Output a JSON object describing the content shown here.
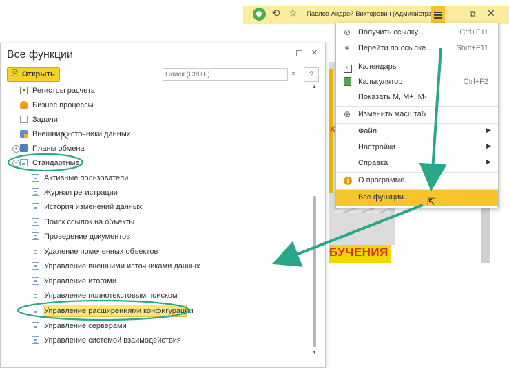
{
  "topbar": {
    "user": "Павлов Андрей Викторович (Администратор)",
    "icons": [
      "home-icon",
      "history-icon",
      "favorites-star-icon"
    ],
    "controls": [
      "minimize",
      "restore",
      "close"
    ]
  },
  "menu": {
    "items": [
      {
        "label": "Получить ссылку...",
        "shortcut": "Ctrl+F11",
        "icon": "paperclip-icon"
      },
      {
        "label": "Перейти по ссылке...",
        "shortcut": "Shift+F11",
        "icon": "link-icon"
      },
      {
        "label": "Календарь",
        "shortcut": "",
        "icon": "calendar-icon"
      },
      {
        "label": "Калькулятор",
        "shortcut": "Ctrl+F2",
        "icon": "calculator-icon"
      },
      {
        "label": "Показать М, М+, М-",
        "shortcut": "",
        "icon": ""
      },
      {
        "label": "Изменить масштаб",
        "shortcut": "",
        "icon": "zoom-icon"
      },
      {
        "label": "Файл",
        "shortcut": "",
        "icon": "",
        "submenu": true
      },
      {
        "label": "Настройки",
        "shortcut": "",
        "icon": "",
        "submenu": true
      },
      {
        "label": "Справка",
        "shortcut": "",
        "icon": "",
        "submenu": true
      },
      {
        "label": "О программе...",
        "shortcut": "",
        "icon": "info-icon"
      },
      {
        "label": "Все функции...",
        "shortcut": "",
        "icon": "",
        "highlighted": true
      }
    ]
  },
  "background": {
    "banner_text": "БУЧЕНИЯ",
    "side_text": "K"
  },
  "window": {
    "title": "Все функции",
    "open_label": "Открыть",
    "search_placeholder": "Поиск (Ctrl+F)",
    "search_clear": "×",
    "help_label": "?",
    "maximize_glyph": "☐",
    "close_glyph": "×",
    "tree": [
      {
        "label": "Регистры расчета",
        "icon": "register-icon",
        "level": 0
      },
      {
        "label": "Бизнес процессы",
        "icon": "business-process-icon",
        "level": 0
      },
      {
        "label": "Задачи",
        "icon": "task-icon",
        "level": 0
      },
      {
        "label": "Внешние источники данных",
        "icon": "external-data-icon",
        "level": 0
      },
      {
        "label": "Планы обмена",
        "icon": "exchange-plan-icon",
        "level": 0,
        "expander": "+"
      },
      {
        "label": "Стандартные",
        "icon": "folder-icon",
        "level": 0,
        "expander": "−",
        "circled": true
      },
      {
        "label": "Активные пользователи",
        "icon": "form-icon",
        "level": 1
      },
      {
        "label": "Журнал регистрации",
        "icon": "form-icon",
        "level": 1
      },
      {
        "label": "История изменений данных",
        "icon": "form-icon",
        "level": 1
      },
      {
        "label": "Поиск ссылок на объекты",
        "icon": "form-icon",
        "level": 1
      },
      {
        "label": "Проведение документов",
        "icon": "form-icon",
        "level": 1
      },
      {
        "label": "Удаление помеченных объектов",
        "icon": "form-icon",
        "level": 1
      },
      {
        "label": "Управление внешними источниками данных",
        "icon": "form-icon",
        "level": 1
      },
      {
        "label": "Управление итогами",
        "icon": "form-icon",
        "level": 1
      },
      {
        "label": "Управление полнотекстовым поиском",
        "icon": "form-icon",
        "level": 1
      },
      {
        "label": "Управление расширениями конфигурации",
        "icon": "form-icon",
        "level": 1,
        "selected": true,
        "circled": true
      },
      {
        "label": "Управление серверами",
        "icon": "form-icon",
        "level": 1
      },
      {
        "label": "Управление системой взаимодействия",
        "icon": "form-icon",
        "level": 1
      }
    ]
  },
  "colors": {
    "accent_yellow": "#f4c430",
    "annotation_green": "#2aa68a",
    "selection_yellow": "#fbe57d",
    "titlebar_yellow": "#fbed9e"
  }
}
